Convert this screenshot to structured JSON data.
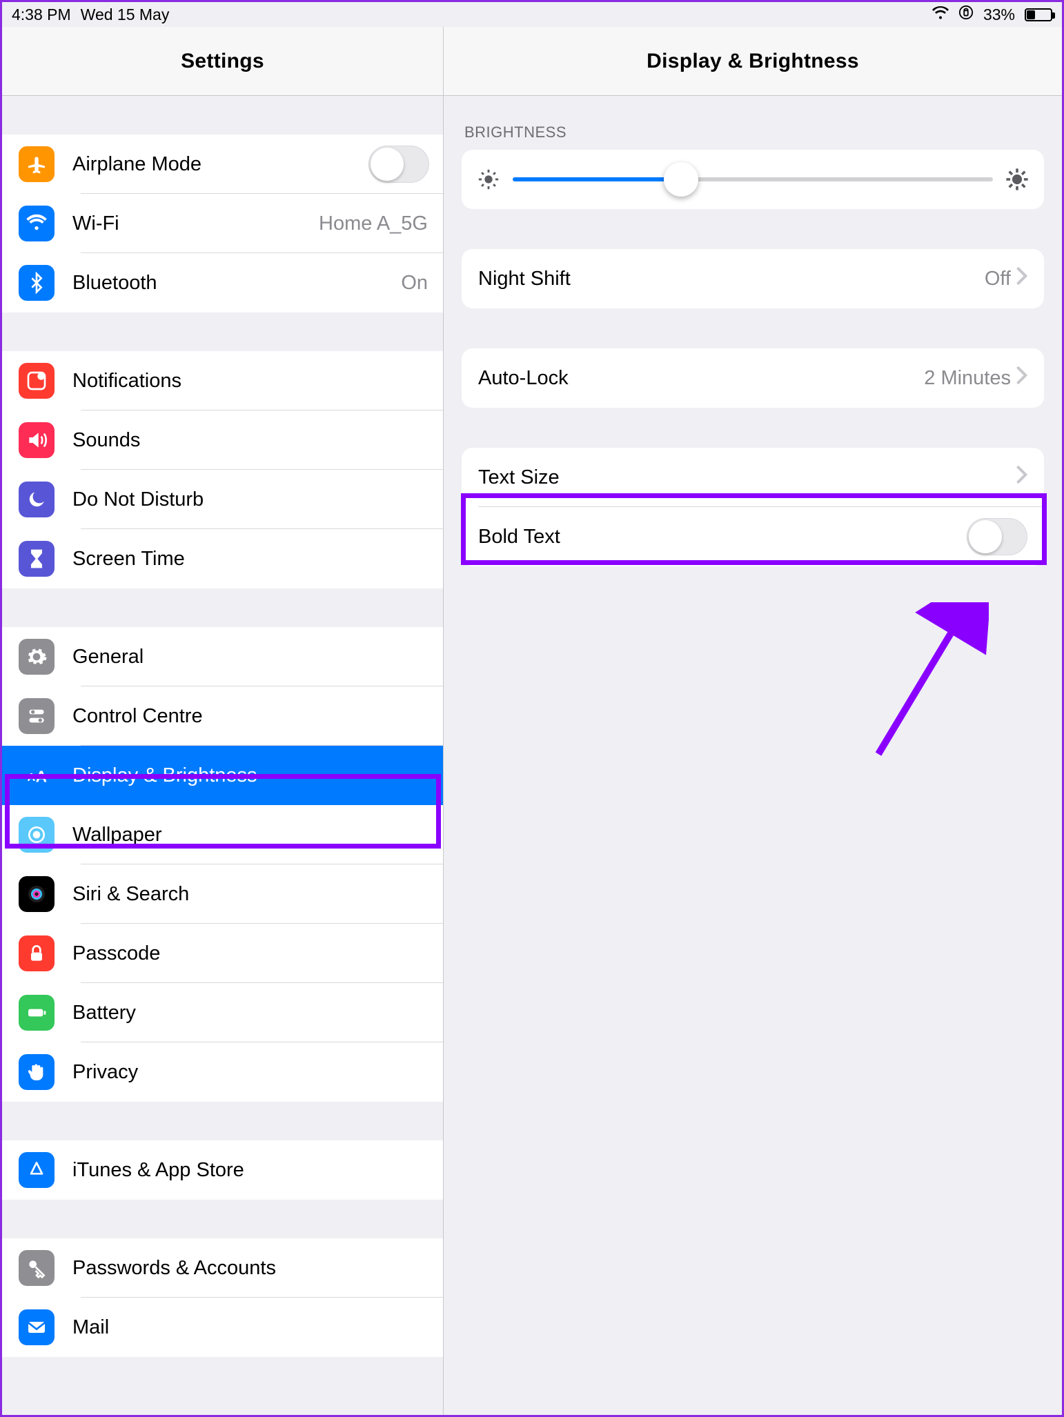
{
  "statusbar": {
    "time": "4:38 PM",
    "date": "Wed 15 May",
    "battery_pct": "33%"
  },
  "sidebar": {
    "title": "Settings",
    "groups": [
      [
        {
          "icon": "airplane-icon",
          "tile": "orange",
          "label": "Airplane Mode",
          "trailing": "toggle",
          "value": ""
        },
        {
          "icon": "wifi-icon",
          "tile": "blue",
          "label": "Wi-Fi",
          "trailing": "value",
          "value": "Home A_5G"
        },
        {
          "icon": "bluetooth-icon",
          "tile": "blue",
          "label": "Bluetooth",
          "trailing": "value",
          "value": "On"
        }
      ],
      [
        {
          "icon": "notifications-icon",
          "tile": "red",
          "label": "Notifications",
          "trailing": "none",
          "value": ""
        },
        {
          "icon": "sounds-icon",
          "tile": "pink",
          "label": "Sounds",
          "trailing": "none",
          "value": ""
        },
        {
          "icon": "moon-icon",
          "tile": "purple",
          "label": "Do Not Disturb",
          "trailing": "none",
          "value": ""
        },
        {
          "icon": "hourglass-icon",
          "tile": "purple",
          "label": "Screen Time",
          "trailing": "none",
          "value": ""
        }
      ],
      [
        {
          "icon": "gear-icon",
          "tile": "gray",
          "label": "General",
          "trailing": "none",
          "value": ""
        },
        {
          "icon": "switches-icon",
          "tile": "gray",
          "label": "Control Centre",
          "trailing": "none",
          "value": ""
        },
        {
          "icon": "text-size-icon",
          "tile": "blue",
          "label": "Display & Brightness",
          "trailing": "none",
          "value": "",
          "selected": true
        },
        {
          "icon": "wallpaper-icon",
          "tile": "bluelight",
          "label": "Wallpaper",
          "trailing": "none",
          "value": ""
        },
        {
          "icon": "siri-icon",
          "tile": "black",
          "label": "Siri & Search",
          "trailing": "none",
          "value": ""
        },
        {
          "icon": "lock-icon",
          "tile": "red",
          "label": "Passcode",
          "trailing": "none",
          "value": ""
        },
        {
          "icon": "battery-icon",
          "tile": "green",
          "label": "Battery",
          "trailing": "none",
          "value": ""
        },
        {
          "icon": "hand-icon",
          "tile": "blue",
          "label": "Privacy",
          "trailing": "none",
          "value": ""
        }
      ],
      [
        {
          "icon": "appstore-icon",
          "tile": "blue",
          "label": "iTunes & App Store",
          "trailing": "none",
          "value": ""
        }
      ],
      [
        {
          "icon": "keys-icon",
          "tile": "gray",
          "label": "Passwords & Accounts",
          "trailing": "none",
          "value": ""
        },
        {
          "icon": "mail-icon",
          "tile": "blue",
          "label": "Mail",
          "trailing": "none",
          "value": ""
        }
      ]
    ]
  },
  "detail": {
    "title": "Display & Brightness",
    "brightness_header": "BRIGHTNESS",
    "brightness_pct": 35,
    "rows": {
      "night_shift": {
        "label": "Night Shift",
        "value": "Off"
      },
      "auto_lock": {
        "label": "Auto-Lock",
        "value": "2 Minutes"
      },
      "text_size": {
        "label": "Text Size",
        "value": ""
      },
      "bold_text": {
        "label": "Bold Text",
        "value": ""
      }
    }
  },
  "annotations": {
    "highlight_sidebar_row": "Display & Brightness",
    "highlight_detail_row": "Text Size",
    "arrow_target": "Bold Text toggle"
  },
  "colors": {
    "accent": "#007aff",
    "annotation": "#8a00ff"
  }
}
